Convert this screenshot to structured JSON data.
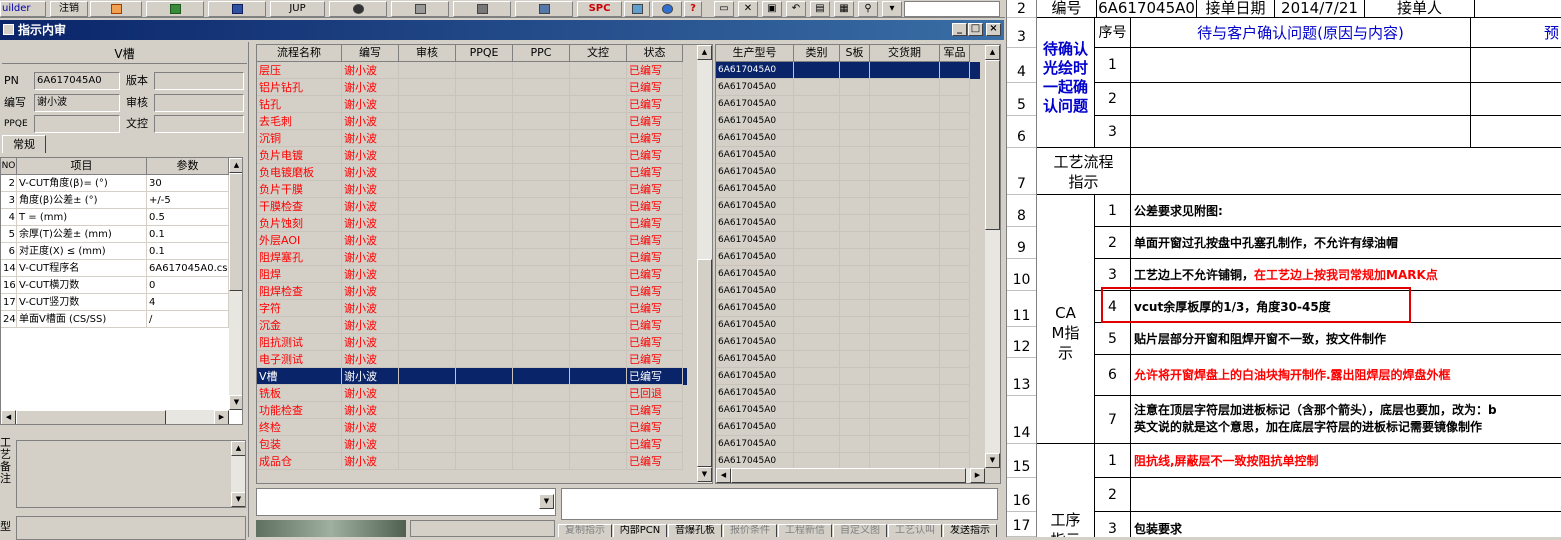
{
  "toolbar": {
    "items": [
      "uilder",
      "注销",
      "",
      "",
      "",
      "JUP",
      "",
      "",
      "",
      "",
      "SPC",
      "",
      "",
      "?"
    ]
  },
  "window": {
    "title": "指示内审",
    "min": "_",
    "max": "□",
    "close": "×"
  },
  "left": {
    "section_title": "V槽",
    "pn_label": "PN",
    "pn_value": "6A617045A0",
    "version_label": "版本",
    "version_value": "",
    "writer_label": "编写",
    "writer_value": "谢小波",
    "review_label": "审核",
    "review_value": "",
    "ppqe_label": "PPQE",
    "ppqe_value": "",
    "doc_label": "文控",
    "doc_value": "",
    "tab": "常规",
    "param_headers": [
      "NO",
      "项目",
      "参数"
    ],
    "params": [
      [
        "2",
        "V-CUT角度(β)=  (°)",
        "30"
      ],
      [
        "3",
        "角度(β)公差±  (°)",
        "+/-5"
      ],
      [
        "4",
        "T =  (mm)",
        "0.5"
      ],
      [
        "5",
        "余厚(T)公差±  (mm)",
        "0.1"
      ],
      [
        "6",
        "对正度(X) ≤ (mm)",
        "0.1"
      ],
      [
        "14",
        "V-CUT程序名",
        "6A617045A0.cs"
      ],
      [
        "16",
        "V-CUT横刀数",
        "0"
      ],
      [
        "17",
        "V-CUT竖刀数",
        "4"
      ],
      [
        "24",
        "单面V槽面 (CS/SS)",
        "/"
      ]
    ],
    "notes_label": "工艺备注",
    "type_label": "型"
  },
  "flow": {
    "headers": [
      "流程名称",
      "编写",
      "审核",
      "PPQE",
      "PPC",
      "文控",
      "状态"
    ],
    "rows": [
      [
        "层压",
        "谢小波",
        "已编写"
      ],
      [
        "铝片钻孔",
        "谢小波",
        "已编写"
      ],
      [
        "钻孔",
        "谢小波",
        "已编写"
      ],
      [
        "去毛刺",
        "谢小波",
        "已编写"
      ],
      [
        "沉铜",
        "谢小波",
        "已编写"
      ],
      [
        "负片电镀",
        "谢小波",
        "已编写"
      ],
      [
        "负电镀磨板",
        "谢小波",
        "已编写"
      ],
      [
        "负片干膜",
        "谢小波",
        "已编写"
      ],
      [
        "干膜检查",
        "谢小波",
        "已编写"
      ],
      [
        "负片蚀刻",
        "谢小波",
        "已编写"
      ],
      [
        "外层AOI",
        "谢小波",
        "已编写"
      ],
      [
        "阻焊塞孔",
        "谢小波",
        "已编写"
      ],
      [
        "阻焊",
        "谢小波",
        "已编写"
      ],
      [
        "阻焊检查",
        "谢小波",
        "已编写"
      ],
      [
        "字符",
        "谢小波",
        "已编写"
      ],
      [
        "沉金",
        "谢小波",
        "已编写"
      ],
      [
        "阻抗测试",
        "谢小波",
        "已编写"
      ],
      [
        "电子测试",
        "谢小波",
        "已编写"
      ],
      [
        "V槽",
        "谢小波",
        "已编写"
      ],
      [
        "铣板",
        "谢小波",
        "已回退"
      ],
      [
        "功能检查",
        "谢小波",
        "已编写"
      ],
      [
        "终检",
        "谢小波",
        "已编写"
      ],
      [
        "包装",
        "谢小波",
        "已编写"
      ],
      [
        "成品仓",
        "谢小波",
        "已编写"
      ]
    ],
    "selected_index": 18
  },
  "models": {
    "headers": [
      "生产型号",
      "类别",
      "S板",
      "交货期",
      "军品"
    ],
    "value": "6A617045A0",
    "count": 24
  },
  "bottom_tabs": [
    "复制指示",
    "内部PCN",
    "音爆孔板",
    "报价条件",
    "工程新信",
    "自定义图",
    "工艺认叫",
    "发送指示"
  ],
  "sheet": {
    "row_numbers": [
      "2",
      "3",
      "4",
      "5",
      "6",
      "7",
      "8",
      "9",
      "10",
      "11",
      "12",
      "13",
      "14",
      "15",
      "16",
      "17"
    ],
    "row2": [
      "编号",
      "6A617045A0",
      "接单日期",
      "2014/7/21",
      "接单人"
    ],
    "seq_header": "序号",
    "pending_header": "待与客户确认问题(原因与内容)",
    "pre_header": "预",
    "pending_label": "待确认光绘时一起确认问题",
    "pending_nums": [
      "1",
      "2",
      "3"
    ],
    "process_label": "工艺流程指示",
    "cam_label": "CAM指示",
    "cam_items": [
      {
        "n": "1",
        "t": "公差要求见附图:",
        "red": false
      },
      {
        "n": "2",
        "t": "单面开窗过孔按盘中孔塞孔制作，不允许有绿油帽",
        "red": false
      },
      {
        "n": "3",
        "t": "工艺边上不允许铺铜，",
        "t2": "在工艺边上按我司常规加MARK点",
        "red": false
      },
      {
        "n": "4",
        "t": "vcut余厚板厚的1/3，角度30-45度",
        "red": false
      },
      {
        "n": "5",
        "t": "贴片层部分开窗和阻焊开窗不一致，按文件制作",
        "red": false
      },
      {
        "n": "6",
        "t": "允许将开窗焊盘上的白油块掏开制作.露出阻焊层的焊盘外框",
        "red": true
      },
      {
        "n": "7",
        "t": "注意在顶层字符层加进板标记（含那个箭头），底层也要加，改为：b",
        "t2": "英文说的就是这个意思，加在底层字符层的进板标记需要镜像制作",
        "red": false
      }
    ],
    "proc_label": "工序指示",
    "proc_items": [
      {
        "n": "1",
        "t": "阻抗线,屏蔽层不一致按阻抗单控制",
        "red": true
      },
      {
        "n": "2",
        "t": "",
        "red": false
      },
      {
        "n": "3",
        "t": "包装要求",
        "red": false
      }
    ]
  },
  "colors": {
    "selection": "#0a246a",
    "red": "#ff0000",
    "blue": "#0000cc",
    "highlight_box": "#e00000"
  }
}
